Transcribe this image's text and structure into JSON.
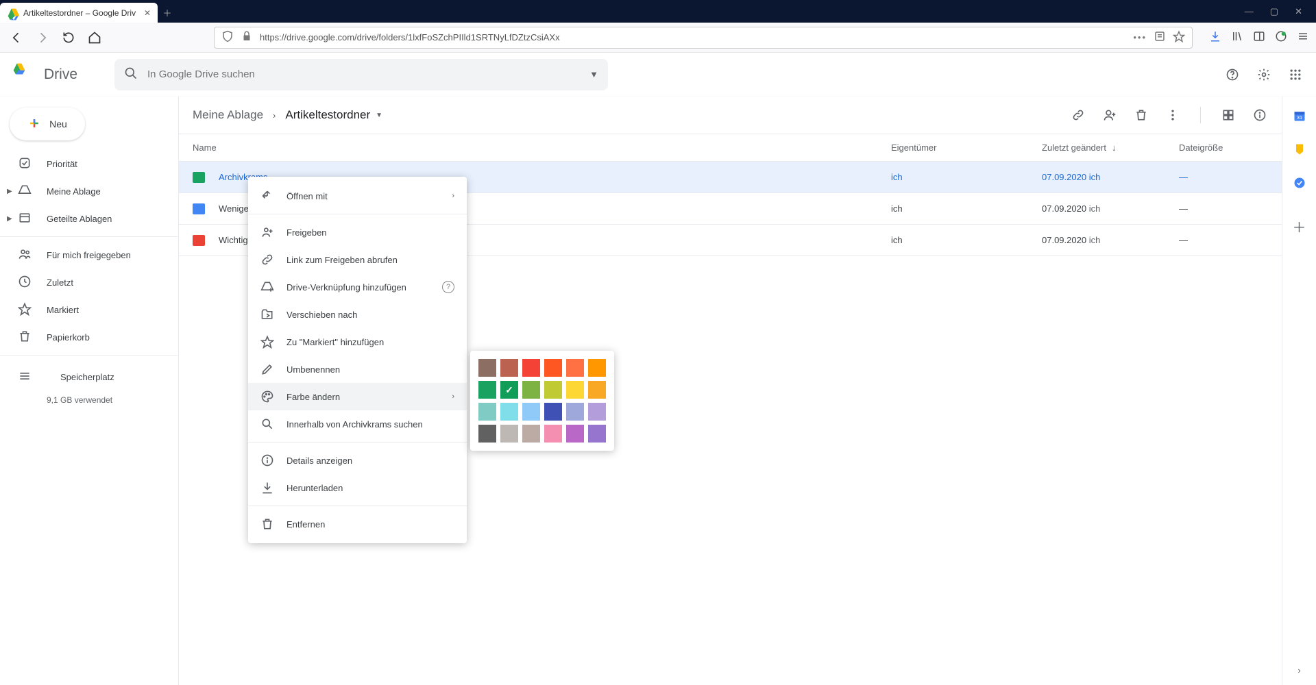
{
  "browser": {
    "tab_title": "Artikeltestordner – Google Driv",
    "url": "https://drive.google.com/drive/folders/1lxfFoSZchPIIld1SRTNyLfDZtzCsiAXx"
  },
  "app_name": "Drive",
  "search_placeholder": "In Google Drive suchen",
  "sidebar": {
    "new_label": "Neu",
    "items": [
      {
        "label": "Priorität"
      },
      {
        "label": "Meine Ablage"
      },
      {
        "label": "Geteilte Ablagen"
      },
      {
        "label": "Für mich freigegeben"
      },
      {
        "label": "Zuletzt"
      },
      {
        "label": "Markiert"
      },
      {
        "label": "Papierkorb"
      }
    ],
    "storage_label": "Speicherplatz",
    "storage_used": "9,1 GB verwendet"
  },
  "breadcrumb": {
    "root": "Meine Ablage",
    "current": "Artikeltestordner"
  },
  "columns": {
    "name": "Name",
    "owner": "Eigentümer",
    "modified": "Zuletzt geändert",
    "size": "Dateigröße"
  },
  "rows": [
    {
      "name": "Archivkrams",
      "owner": "ich",
      "date": "07.09.2020",
      "who": "ich",
      "size": "—",
      "color": "#1aa260"
    },
    {
      "name": "Weniger wichtig",
      "owner": "ich",
      "date": "07.09.2020",
      "who": "ich",
      "size": "—",
      "color": "#4285f4"
    },
    {
      "name": "Wichtig",
      "owner": "ich",
      "date": "07.09.2020",
      "who": "ich",
      "size": "—",
      "color": "#ea4335"
    }
  ],
  "context_menu": {
    "open_with": "Öffnen mit",
    "share": "Freigeben",
    "get_link": "Link zum Freigeben abrufen",
    "add_shortcut": "Drive-Verknüpfung hinzufügen",
    "move_to": "Verschieben nach",
    "add_starred": "Zu \"Markiert\" hinzufügen",
    "rename": "Umbenennen",
    "change_color": "Farbe ändern",
    "search_within": "Innerhalb von Archivkrams suchen",
    "view_details": "Details anzeigen",
    "download": "Herunterladen",
    "remove": "Entfernen"
  },
  "colors": [
    "#8d6e63",
    "#bc6251",
    "#f44336",
    "#ff5722",
    "#ff7043",
    "#ff9800",
    "#1aa260",
    "#0f9d58",
    "#7cb342",
    "#c0ca33",
    "#fdd835",
    "#f9a825",
    "#80cbc4",
    "#80deea",
    "#90caf9",
    "#3f51b5",
    "#9fa8da",
    "#b39ddb",
    "#616161",
    "#bdb8b4",
    "#bcaaa4",
    "#f48fb1",
    "#ba68c8",
    "#9575cd"
  ],
  "selected_color_index": 7
}
